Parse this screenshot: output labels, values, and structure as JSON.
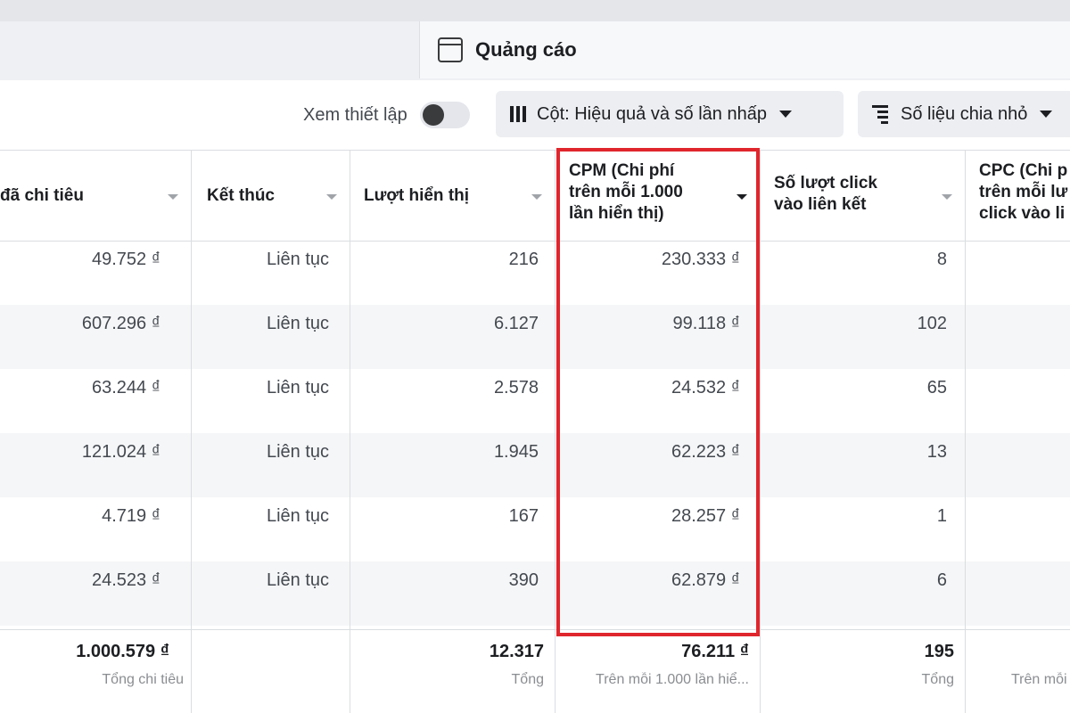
{
  "header": {
    "tab_label": "Quảng cáo"
  },
  "toolbar": {
    "view_setup_label": "Xem thiết lập",
    "view_setup_enabled": false,
    "columns_button_label": "Cột: Hiệu quả và số lần nhấp",
    "breakdown_button_label": "Số liệu chia nhỏ"
  },
  "table": {
    "columns": [
      "đã chi tiêu",
      "Kết thúc",
      "Lượt hiển thị",
      "CPM (Chi phí trên mỗi 1.000 lần hiển thị)",
      "Số lượt click vào liên kết",
      "CPC (Chi phí trên mỗi lượt click vào liên kết)"
    ],
    "header_lines": {
      "cpm": [
        "CPM (Chi phí",
        "trên mỗi 1.000",
        "lần hiển thị)"
      ],
      "clicks": [
        "Số lượt click",
        "vào liên kết"
      ],
      "cpc": [
        "CPC (Chi p",
        "trên mỗi lư",
        "click vào li"
      ]
    },
    "rows": [
      {
        "spent": "49.752 ₫",
        "end": "Liên tục",
        "impressions": "216",
        "cpm": "230.333 ₫",
        "clicks": "8",
        "cpc": ""
      },
      {
        "spent": "607.296 ₫",
        "end": "Liên tục",
        "impressions": "6.127",
        "cpm": "99.118 ₫",
        "clicks": "102",
        "cpc": ""
      },
      {
        "spent": "63.244 ₫",
        "end": "Liên tục",
        "impressions": "2.578",
        "cpm": "24.532 ₫",
        "clicks": "65",
        "cpc": ""
      },
      {
        "spent": "121.024 ₫",
        "end": "Liên tục",
        "impressions": "1.945",
        "cpm": "62.223 ₫",
        "clicks": "13",
        "cpc": ""
      },
      {
        "spent": "4.719 ₫",
        "end": "Liên tục",
        "impressions": "167",
        "cpm": "28.257 ₫",
        "clicks": "1",
        "cpc": ""
      },
      {
        "spent": "24.523 ₫",
        "end": "Liên tục",
        "impressions": "390",
        "cpm": "62.879 ₫",
        "clicks": "6",
        "cpc": ""
      }
    ],
    "totals": {
      "spent": {
        "value": "1.000.579 ₫",
        "label": "Tổng chi tiêu"
      },
      "impressions": {
        "value": "12.317",
        "label": "Tổng"
      },
      "cpm": {
        "value": "76.211 ₫",
        "label": "Trên mỗi 1.000 lần hiể..."
      },
      "clicks": {
        "value": "195",
        "label": "Tổng"
      },
      "cpc": {
        "value": "",
        "label": "Trên mỗi"
      }
    }
  },
  "colors": {
    "highlight_border": "#e0262d",
    "band": "#f5f6f7",
    "grid": "#dadde1"
  }
}
